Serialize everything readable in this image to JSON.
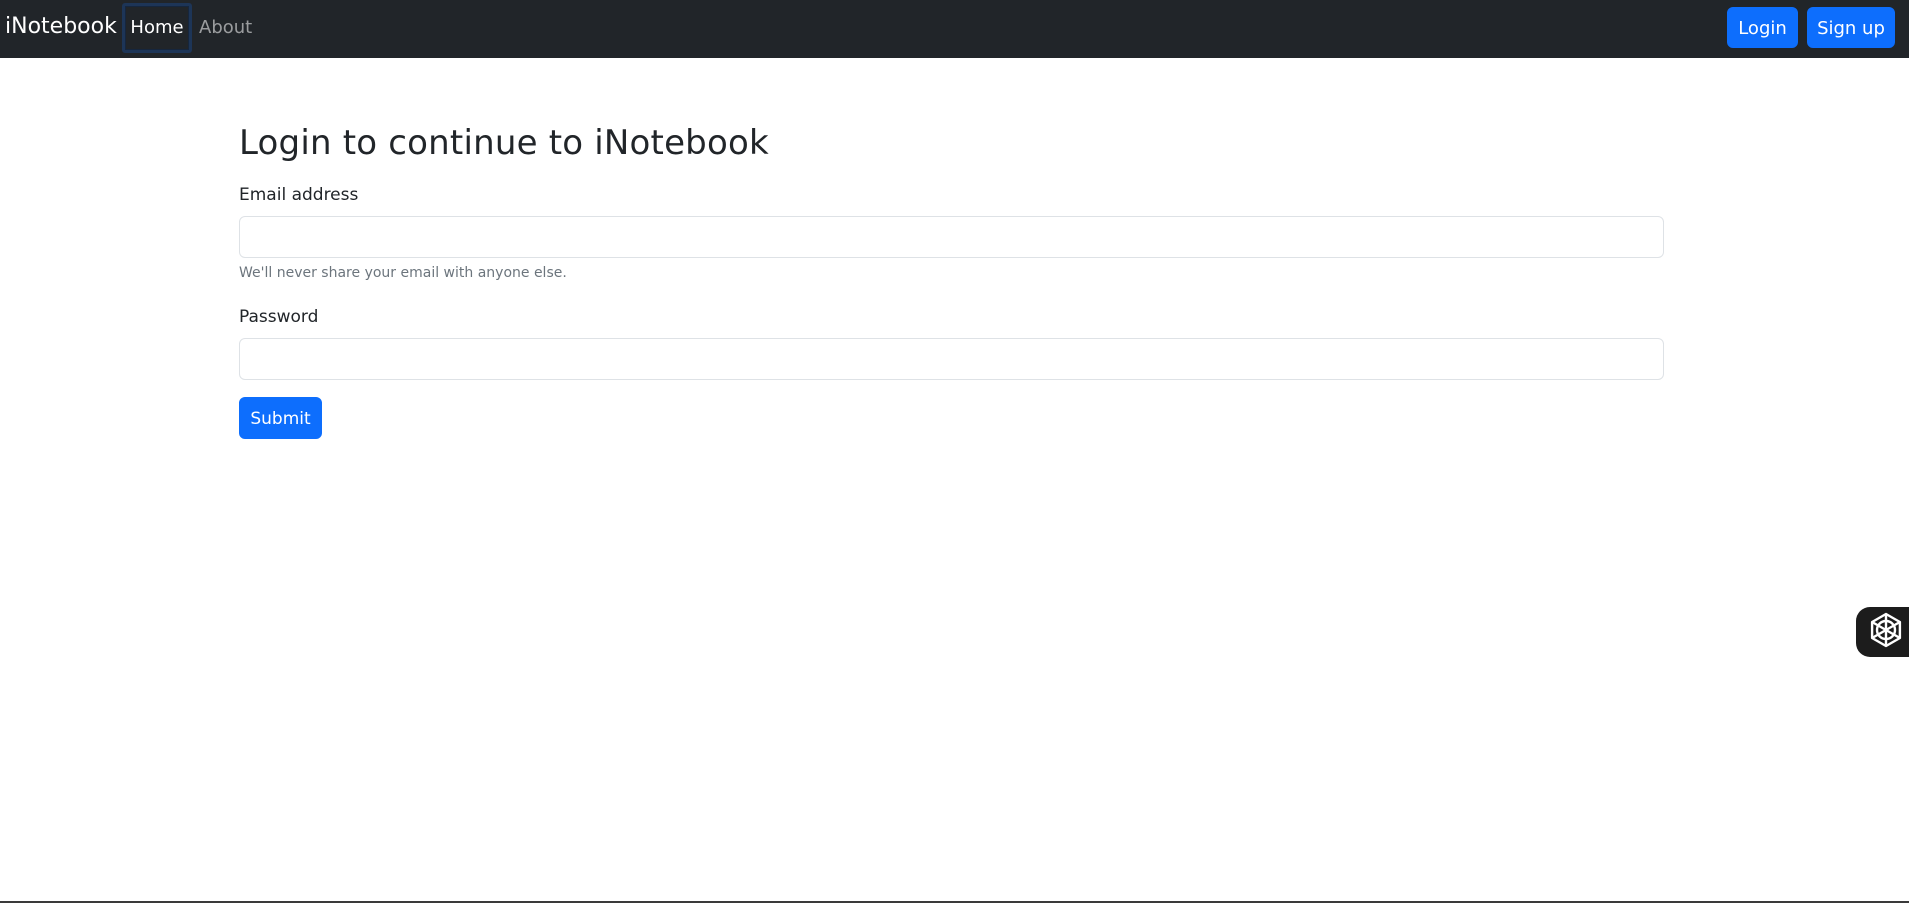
{
  "navbar": {
    "brand": "iNotebook",
    "links": [
      {
        "label": "Home",
        "active": true
      },
      {
        "label": "About",
        "active": false
      }
    ],
    "buttons": {
      "login": "Login",
      "signup": "Sign up"
    }
  },
  "main": {
    "title": "Login to continue to iNotebook",
    "email": {
      "label": "Email address",
      "value": "",
      "help": "We'll never share your email with anyone else."
    },
    "password": {
      "label": "Password",
      "value": ""
    },
    "submit_label": "Submit"
  },
  "widget": {
    "icon": "openai-knot-icon"
  },
  "colors": {
    "navbar_bg": "#212529",
    "primary": "#0d6efd",
    "text": "#212529",
    "muted": "#6c757d"
  }
}
